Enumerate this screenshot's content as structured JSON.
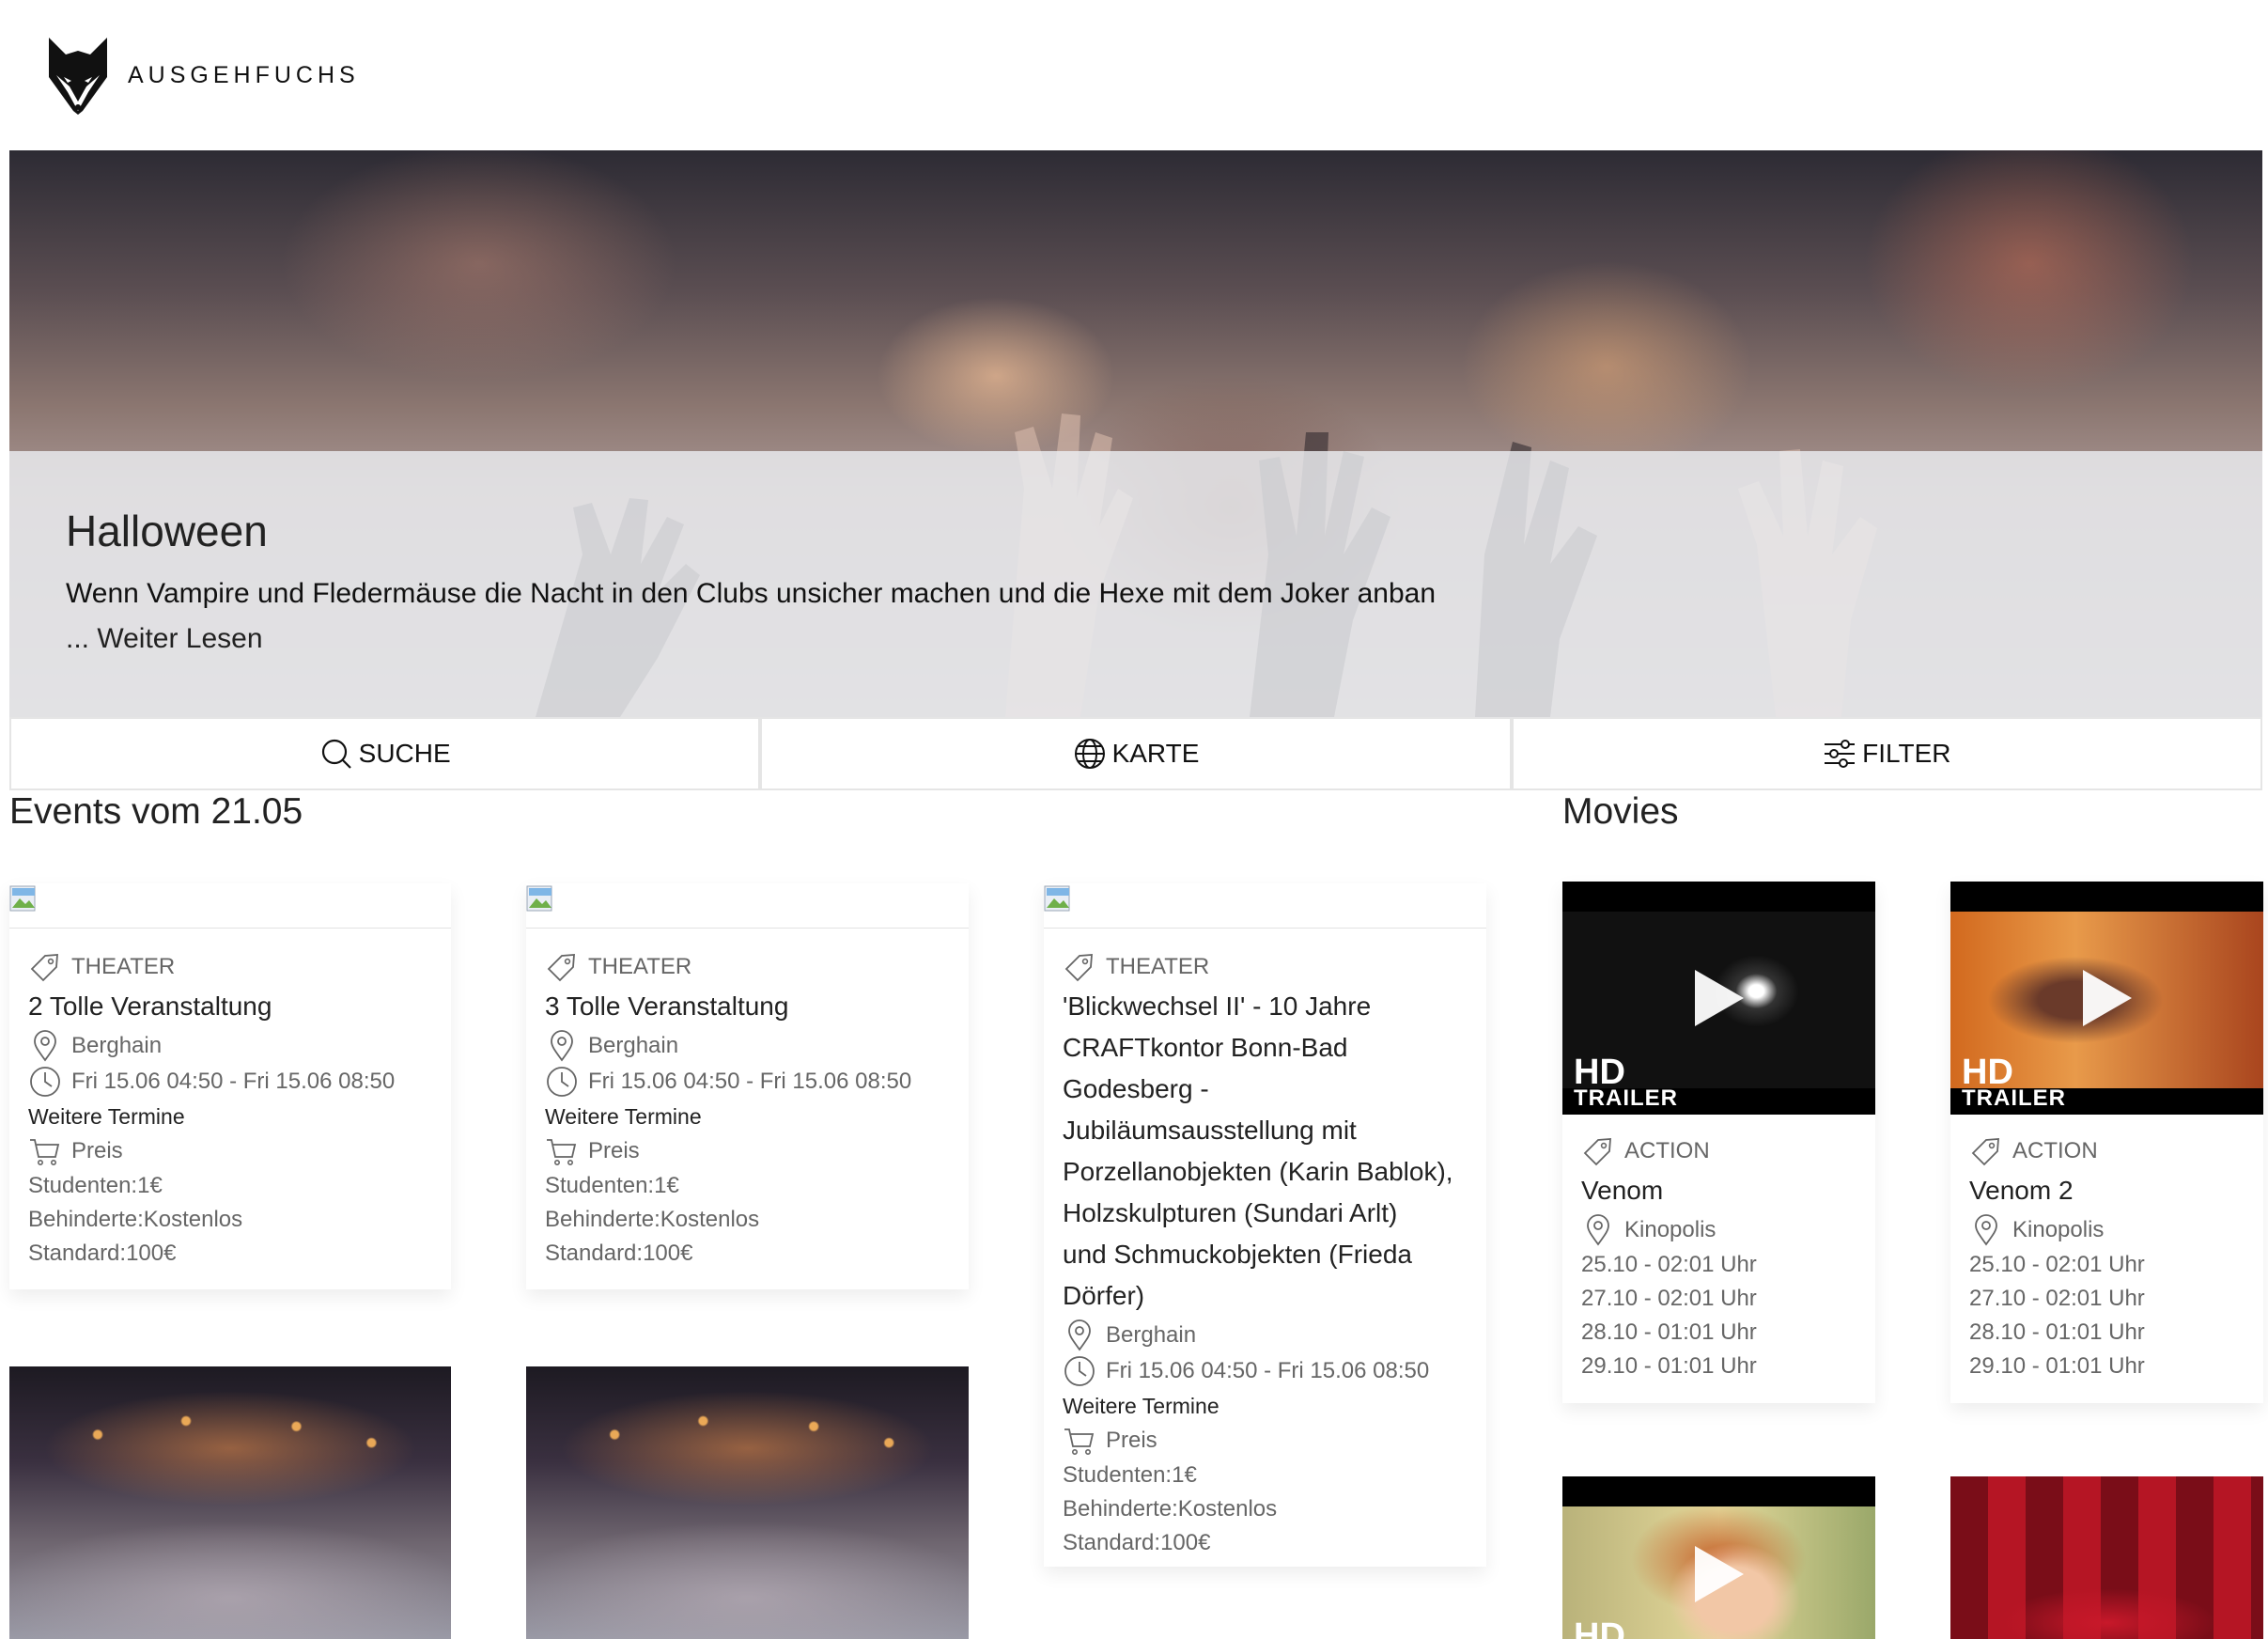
{
  "header": {
    "brand": "AUSGEHFUCHS"
  },
  "hero": {
    "title": "Halloween",
    "text": "Wenn Vampire und Fledermäuse die Nacht in den Clubs unsicher machen und die Hexe mit dem Joker anban",
    "more": "... Weiter Lesen"
  },
  "tabs": [
    {
      "label": "SUCHE",
      "icon": "search-icon"
    },
    {
      "label": "KARTE",
      "icon": "globe-icon"
    },
    {
      "label": "FILTER",
      "icon": "filter-icon"
    }
  ],
  "events": {
    "heading": "Events vom 21.05",
    "cards": [
      {
        "category": "THEATER",
        "title": "2 Tolle Veranstaltung",
        "location": "Berghain",
        "time": "Fri 15.06 04:50 - Fri 15.06 08:50",
        "more_dates": "Weitere Termine",
        "price_label": "Preis",
        "prices": [
          "Studenten:1€",
          "Behinderte:Kostenlos",
          "Standard:100€"
        ]
      },
      {
        "category": "THEATER",
        "title": "3 Tolle Veranstaltung",
        "location": "Berghain",
        "time": "Fri 15.06 04:50 - Fri 15.06 08:50",
        "more_dates": "Weitere Termine",
        "price_label": "Preis",
        "prices": [
          "Studenten:1€",
          "Behinderte:Kostenlos",
          "Standard:100€"
        ]
      },
      {
        "category": "THEATER",
        "title_lines": [
          "'Blickwechsel II' - 10 Jahre",
          "CRAFTkontor Bonn-Bad",
          "Godesberg -",
          "Jubiläumsausstellung mit",
          "Porzellanobjekten (Karin Bablok),",
          "Holzskulpturen (Sundari Arlt)",
          "und Schmuckobjekten (Frieda",
          "Dörfer)"
        ],
        "location": "Berghain",
        "time": "Fri 15.06 04:50 - Fri 15.06 08:50",
        "more_dates": "Weitere Termine",
        "price_label": "Preis",
        "prices": [
          "Studenten:1€",
          "Behinderte:Kostenlos",
          "Standard:100€"
        ]
      }
    ]
  },
  "movies": {
    "heading": "Movies",
    "cards": [
      {
        "genre": "ACTION",
        "title": "Venom",
        "cinema": "Kinopolis",
        "times": [
          "25.10 - 02:01 Uhr",
          "27.10 - 02:01 Uhr",
          "28.10 - 01:01 Uhr",
          "29.10 - 01:01 Uhr"
        ],
        "badge_hd": "HD",
        "badge_trailer": "TRAILER"
      },
      {
        "genre": "ACTION",
        "title": "Venom 2",
        "cinema": "Kinopolis",
        "times": [
          "25.10 - 02:01 Uhr",
          "27.10 - 02:01 Uhr",
          "28.10 - 01:01 Uhr",
          "29.10 - 01:01 Uhr"
        ],
        "badge_hd": "HD",
        "badge_trailer": "TRAILER"
      }
    ],
    "bottom_badge_hd": "HD"
  },
  "colors": {
    "accent_text": "#222222",
    "muted_text": "#666666",
    "border": "#e5e5e5"
  }
}
